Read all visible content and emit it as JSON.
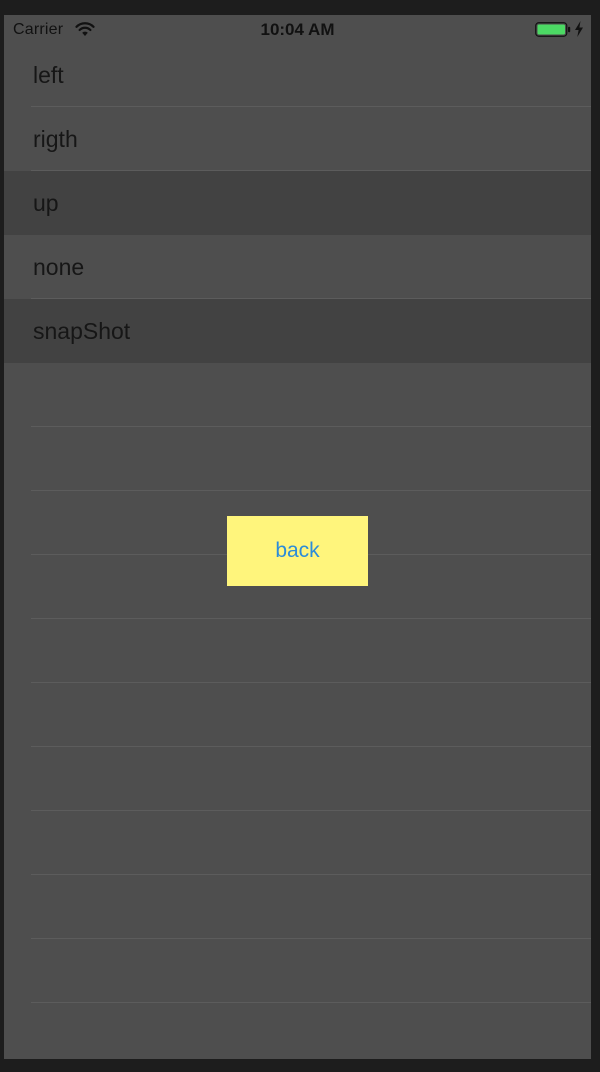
{
  "status_bar": {
    "carrier": "Carrier",
    "time": "10:04 AM",
    "battery_color": "#4cd964"
  },
  "table": {
    "rows": [
      {
        "label": "left",
        "selected": false
      },
      {
        "label": "rigth",
        "selected": false
      },
      {
        "label": "up",
        "selected": true
      },
      {
        "label": "none",
        "selected": false
      },
      {
        "label": "snapShot",
        "selected": true
      }
    ],
    "empty_rows": 11
  },
  "back_button": {
    "label": "back",
    "background": "#fff57c",
    "text_color": "#2c8cd9"
  }
}
